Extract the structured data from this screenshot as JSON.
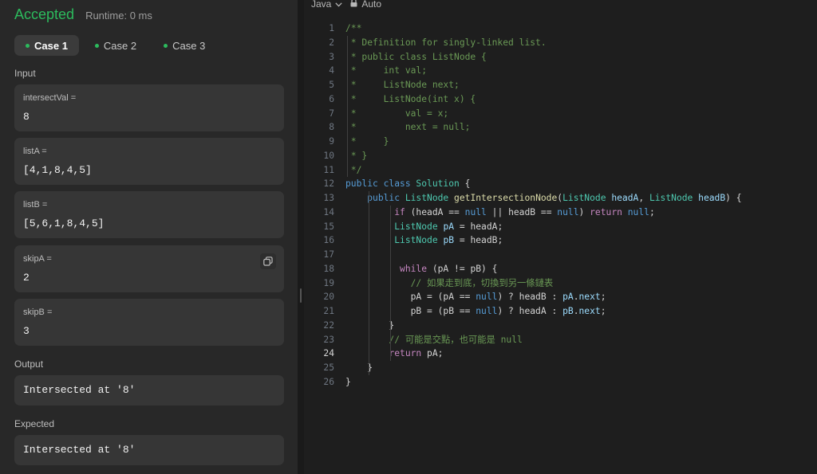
{
  "result": {
    "status": "Accepted",
    "runtime": "Runtime: 0 ms"
  },
  "cases": [
    "Case 1",
    "Case 2",
    "Case 3"
  ],
  "input": {
    "label": "Input",
    "params": [
      {
        "name": "intersectVal =",
        "value": "8"
      },
      {
        "name": "listA =",
        "value": "[4,1,8,4,5]"
      },
      {
        "name": "listB =",
        "value": "[5,6,1,8,4,5]"
      },
      {
        "name": "skipA =",
        "value": "2"
      },
      {
        "name": "skipB =",
        "value": "3"
      }
    ]
  },
  "output": {
    "label": "Output",
    "value": "Intersected at '8'"
  },
  "expected": {
    "label": "Expected",
    "value": "Intersected at '8'"
  },
  "editor": {
    "language": "Java",
    "mode": "Auto",
    "current_line": 24,
    "lines": [
      [
        [
          "c",
          "/**"
        ]
      ],
      [
        [
          "c",
          " * Definition for singly-linked list."
        ]
      ],
      [
        [
          "c",
          " * public class ListNode {"
        ]
      ],
      [
        [
          "c",
          " *     int val;"
        ]
      ],
      [
        [
          "c",
          " *     ListNode next;"
        ]
      ],
      [
        [
          "c",
          " *     ListNode(int x) {"
        ]
      ],
      [
        [
          "c",
          " *         val = x;"
        ]
      ],
      [
        [
          "c",
          " *         next = null;"
        ]
      ],
      [
        [
          "c",
          " *     }"
        ]
      ],
      [
        [
          "c",
          " * }"
        ]
      ],
      [
        [
          "c",
          " */"
        ]
      ],
      [
        [
          "kw",
          "public "
        ],
        [
          "kw",
          "class "
        ],
        [
          "ty",
          "Solution"
        ],
        [
          "",
          " {"
        ]
      ],
      [
        [
          "",
          "    "
        ],
        [
          "kw",
          "public "
        ],
        [
          "ty",
          "ListNode "
        ],
        [
          "fn",
          "getIntersectionNode"
        ],
        [
          "",
          "("
        ],
        [
          "ty",
          "ListNode "
        ],
        [
          "pa",
          "headA"
        ],
        [
          "",
          ", "
        ],
        [
          "ty",
          "ListNode "
        ],
        [
          "pa",
          "headB"
        ],
        [
          "",
          ") {"
        ]
      ],
      [
        [
          "",
          "         "
        ],
        [
          "ctl",
          "if"
        ],
        [
          "",
          " (headA == "
        ],
        [
          "kw",
          "null"
        ],
        [
          "",
          " || headB == "
        ],
        [
          "kw",
          "null"
        ],
        [
          "",
          ") "
        ],
        [
          "ctl",
          "return "
        ],
        [
          "kw",
          "null"
        ],
        [
          "",
          ";"
        ]
      ],
      [
        [
          "",
          "         "
        ],
        [
          "ty",
          "ListNode "
        ],
        [
          "pa",
          "pA"
        ],
        [
          "",
          " = headA;"
        ]
      ],
      [
        [
          "",
          "         "
        ],
        [
          "ty",
          "ListNode "
        ],
        [
          "pa",
          "pB"
        ],
        [
          "",
          " = headB;"
        ]
      ],
      [
        [
          "",
          ""
        ]
      ],
      [
        [
          "",
          "          "
        ],
        [
          "ctl",
          "while"
        ],
        [
          "",
          " (pA != pB) {"
        ]
      ],
      [
        [
          "",
          "            "
        ],
        [
          "c",
          "// 如果走到底，切換到另一條鏈表"
        ]
      ],
      [
        [
          "",
          "            pA = (pA == "
        ],
        [
          "kw",
          "null"
        ],
        [
          "",
          ") ? headB : "
        ],
        [
          "pa",
          "pA"
        ],
        [
          "",
          "."
        ],
        [
          "pa",
          "next"
        ],
        [
          "",
          ";"
        ]
      ],
      [
        [
          "",
          "            pB = (pB == "
        ],
        [
          "kw",
          "null"
        ],
        [
          "",
          ") ? headA : "
        ],
        [
          "pa",
          "pB"
        ],
        [
          "",
          "."
        ],
        [
          "pa",
          "next"
        ],
        [
          "",
          ";"
        ]
      ],
      [
        [
          "",
          "        }"
        ]
      ],
      [
        [
          "",
          "        "
        ],
        [
          "c",
          "// 可能是交點，也可能是 null"
        ]
      ],
      [
        [
          "",
          "        "
        ],
        [
          "ctl",
          "return "
        ],
        [
          "",
          "pA;"
        ]
      ],
      [
        [
          "",
          "    }"
        ]
      ],
      [
        [
          "",
          "}"
        ]
      ]
    ]
  }
}
